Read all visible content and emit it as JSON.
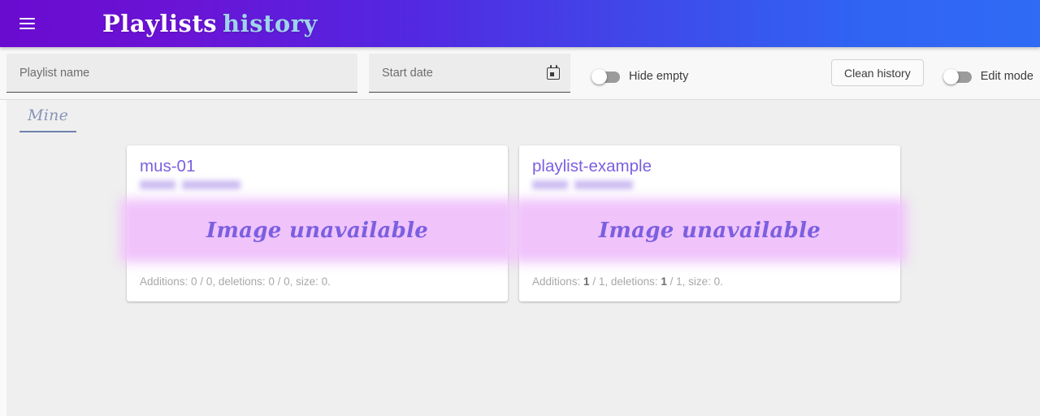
{
  "header": {
    "menu_icon": "hamburger-menu-icon",
    "title_primary": "Playlists",
    "title_secondary": "history"
  },
  "toolbar": {
    "playlist_name_placeholder": "Playlist name",
    "playlist_name_value": "",
    "start_date_placeholder": "Start date",
    "start_date_value": "",
    "calendar_icon": "calendar-icon",
    "hide_empty_label": "Hide empty",
    "hide_empty_on": false,
    "clean_history_label": "Clean history",
    "edit_mode_label": "Edit mode",
    "edit_mode_on": false
  },
  "tabs": [
    {
      "label": "Mine",
      "active": true
    }
  ],
  "cards": [
    {
      "title": "mus-01",
      "subtitle_redacted": " ",
      "banner_text": "Image unavailable",
      "stats_prefix": "Additions: ",
      "additions_value": "0",
      "stats_mid1": " / 0, deletions: ",
      "deletions_value": "0",
      "stats_mid2": " / 0, size: 0.",
      "additions_bold": false
    },
    {
      "title": "playlist-example",
      "subtitle_redacted": " ",
      "banner_text": "Image unavailable",
      "stats_prefix": "Additions: ",
      "additions_value": "1",
      "stats_mid1": " / 1, deletions: ",
      "deletions_value": "1",
      "stats_mid2": " / 1, size: 0.",
      "additions_bold": true
    }
  ],
  "colors": {
    "header_gradient_start": "#6a0bd0",
    "header_gradient_end": "#2f6bf5",
    "title_accent": "#9fd4ea",
    "card_title": "#7b5fe0",
    "banner_bg": "#f0c3fb",
    "tab_active": "#6f82ad"
  }
}
